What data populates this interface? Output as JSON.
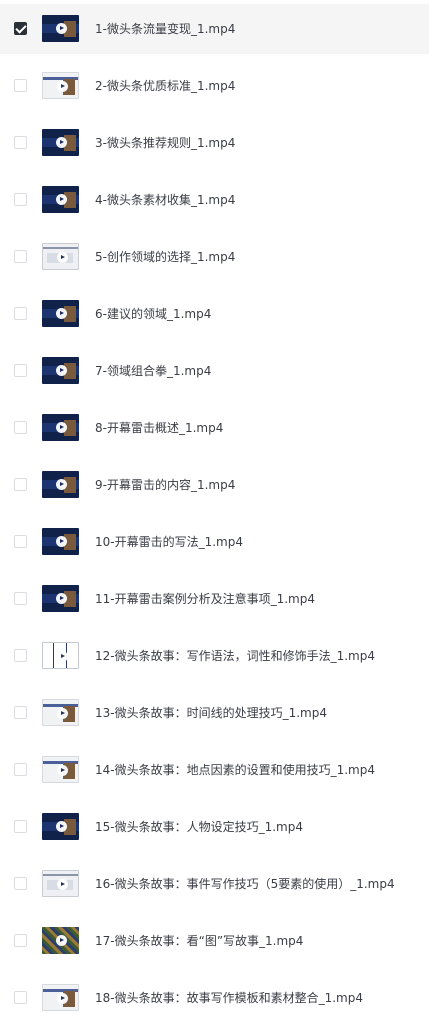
{
  "files": [
    {
      "name": "1-微头条流量变现_1.mp4",
      "checked": true,
      "thumb": "dark"
    },
    {
      "name": "2-微头条优质标准_1.mp4",
      "checked": false,
      "thumb": "light"
    },
    {
      "name": "3-微头条推荐规则_1.mp4",
      "checked": false,
      "thumb": "dark"
    },
    {
      "name": "4-微头条素材收集_1.mp4",
      "checked": false,
      "thumb": "dark"
    },
    {
      "name": "5-创作领域的选择_1.mp4",
      "checked": false,
      "thumb": "sheet"
    },
    {
      "name": "6-建议的领域_1.mp4",
      "checked": false,
      "thumb": "dark"
    },
    {
      "name": "7-领域组合拳_1.mp4",
      "checked": false,
      "thumb": "dark"
    },
    {
      "name": "8-开幕雷击概述_1.mp4",
      "checked": false,
      "thumb": "dark"
    },
    {
      "name": "9-开幕雷击的内容_1.mp4",
      "checked": false,
      "thumb": "dark"
    },
    {
      "name": "10-开幕雷击的写法_1.mp4",
      "checked": false,
      "thumb": "dark"
    },
    {
      "name": "11-开幕雷击案例分析及注意事项_1.mp4",
      "checked": false,
      "thumb": "dark"
    },
    {
      "name": "12-微头条故事：写作语法，词性和修饰手法_1.mp4",
      "checked": false,
      "thumb": "columns"
    },
    {
      "name": "13-微头条故事：时间线的处理技巧_1.mp4",
      "checked": false,
      "thumb": "light"
    },
    {
      "name": "14-微头条故事：地点因素的设置和使用技巧_1.mp4",
      "checked": false,
      "thumb": "light"
    },
    {
      "name": "15-微头条故事：人物设定技巧_1.mp4",
      "checked": false,
      "thumb": "dark"
    },
    {
      "name": "16-微头条故事：事件写作技巧（5要素的使用）_1.mp4",
      "checked": false,
      "thumb": "sheet"
    },
    {
      "name": "17-微头条故事：看“图”写故事_1.mp4",
      "checked": false,
      "thumb": "mosaic"
    },
    {
      "name": "18-微头条故事：故事写作模板和素材整合_1.mp4",
      "checked": false,
      "thumb": "light"
    }
  ]
}
